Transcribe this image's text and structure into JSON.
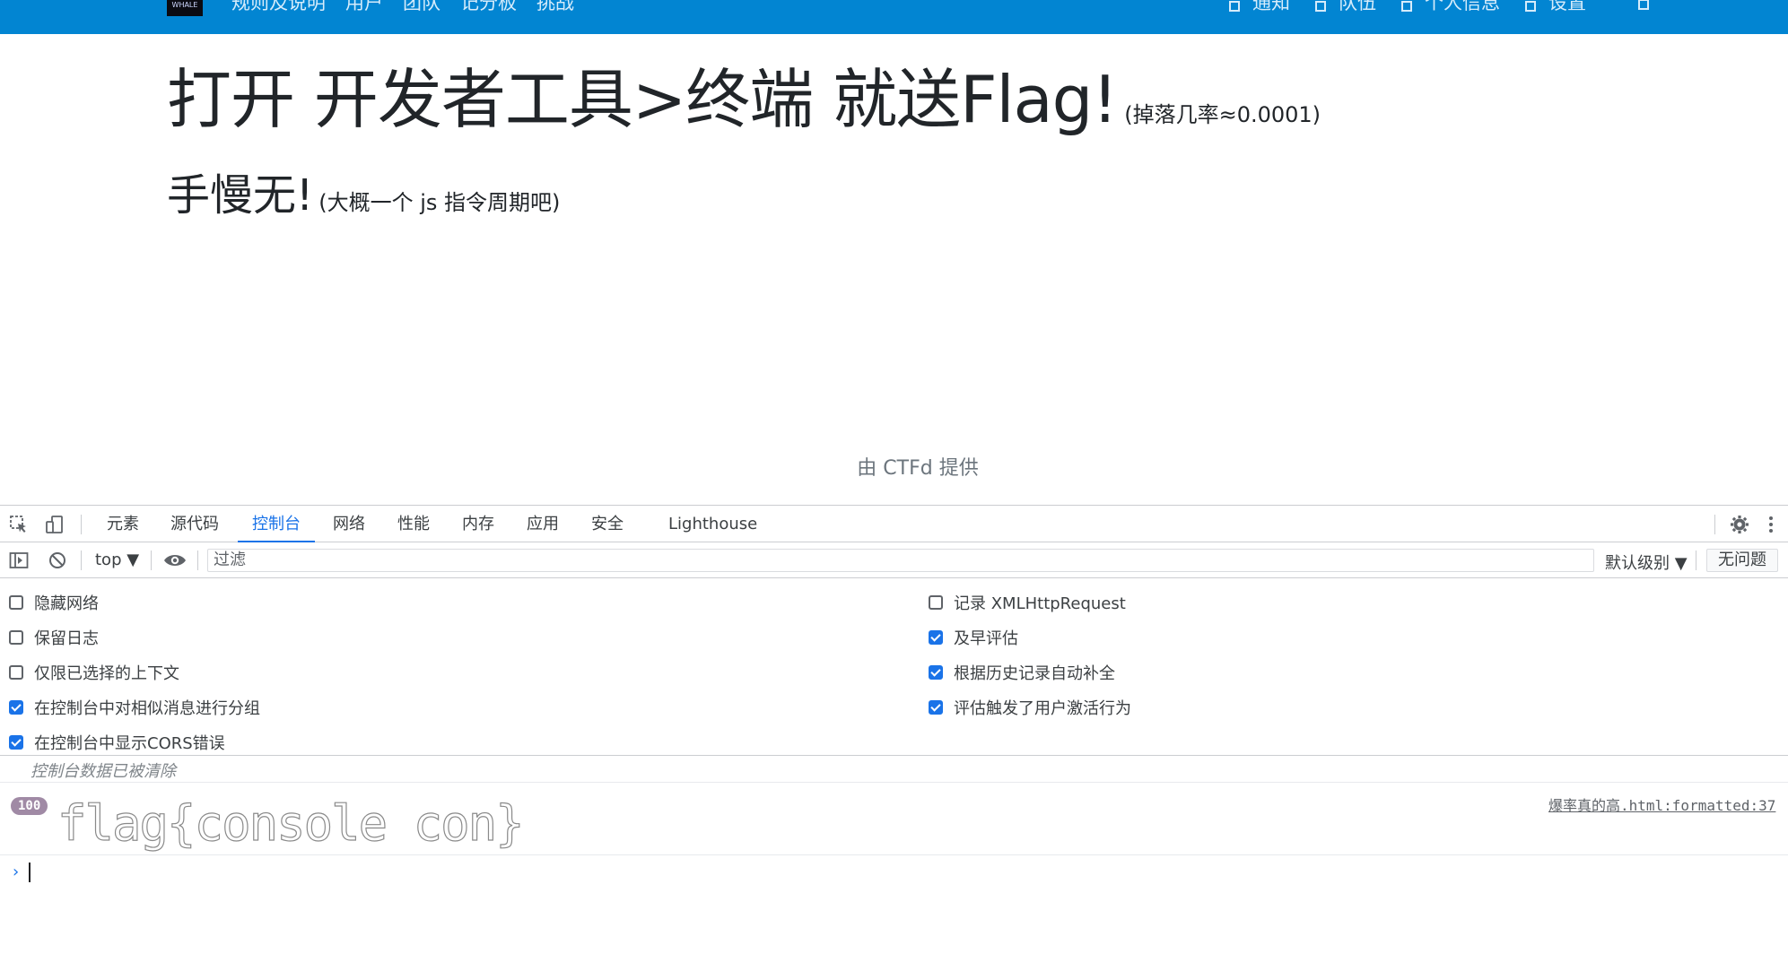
{
  "navbar": {
    "logo_text": "WHALE",
    "left_links": [
      "规则及说明",
      "用户",
      "团队",
      "记分板",
      "挑战"
    ],
    "right_links": [
      "通知",
      "队伍",
      "个人信息",
      "设置"
    ]
  },
  "main": {
    "title": "打开 开发者工具>终端 就送Flag!",
    "title_note": "(掉落几率≈0.0001)",
    "subtitle": "手慢无!",
    "subtitle_note": "(大概一个 js 指令周期吧)",
    "footer": "由 CTFd 提供"
  },
  "devtools": {
    "tabs": [
      "元素",
      "源代码",
      "控制台",
      "网络",
      "性能",
      "内存",
      "应用",
      "安全",
      "Lighthouse"
    ],
    "active_tab": "控制台",
    "context": "top ▼",
    "filter_placeholder": "过滤",
    "level": "默认级别 ▼",
    "issues": "无问题",
    "left_options": [
      {
        "label": "隐藏网络",
        "checked": false
      },
      {
        "label": "保留日志",
        "checked": false
      },
      {
        "label": "仅限已选择的上下文",
        "checked": false
      },
      {
        "label": "在控制台中对相似消息进行分组",
        "checked": true
      },
      {
        "label": "在控制台中显示CORS错误",
        "checked": true
      }
    ],
    "right_options": [
      {
        "label": "记录 XMLHttpRequest",
        "checked": false
      },
      {
        "label": "及早评估",
        "checked": true
      },
      {
        "label": "根据历史记录自动补全",
        "checked": true
      },
      {
        "label": "评估触发了用户激活行为",
        "checked": true
      }
    ],
    "cleared_message": "控制台数据已被清除",
    "message": {
      "count": "100",
      "text": "flag{console con}",
      "source": "爆率真的高.html:formatted:37"
    },
    "prompt": "›"
  }
}
